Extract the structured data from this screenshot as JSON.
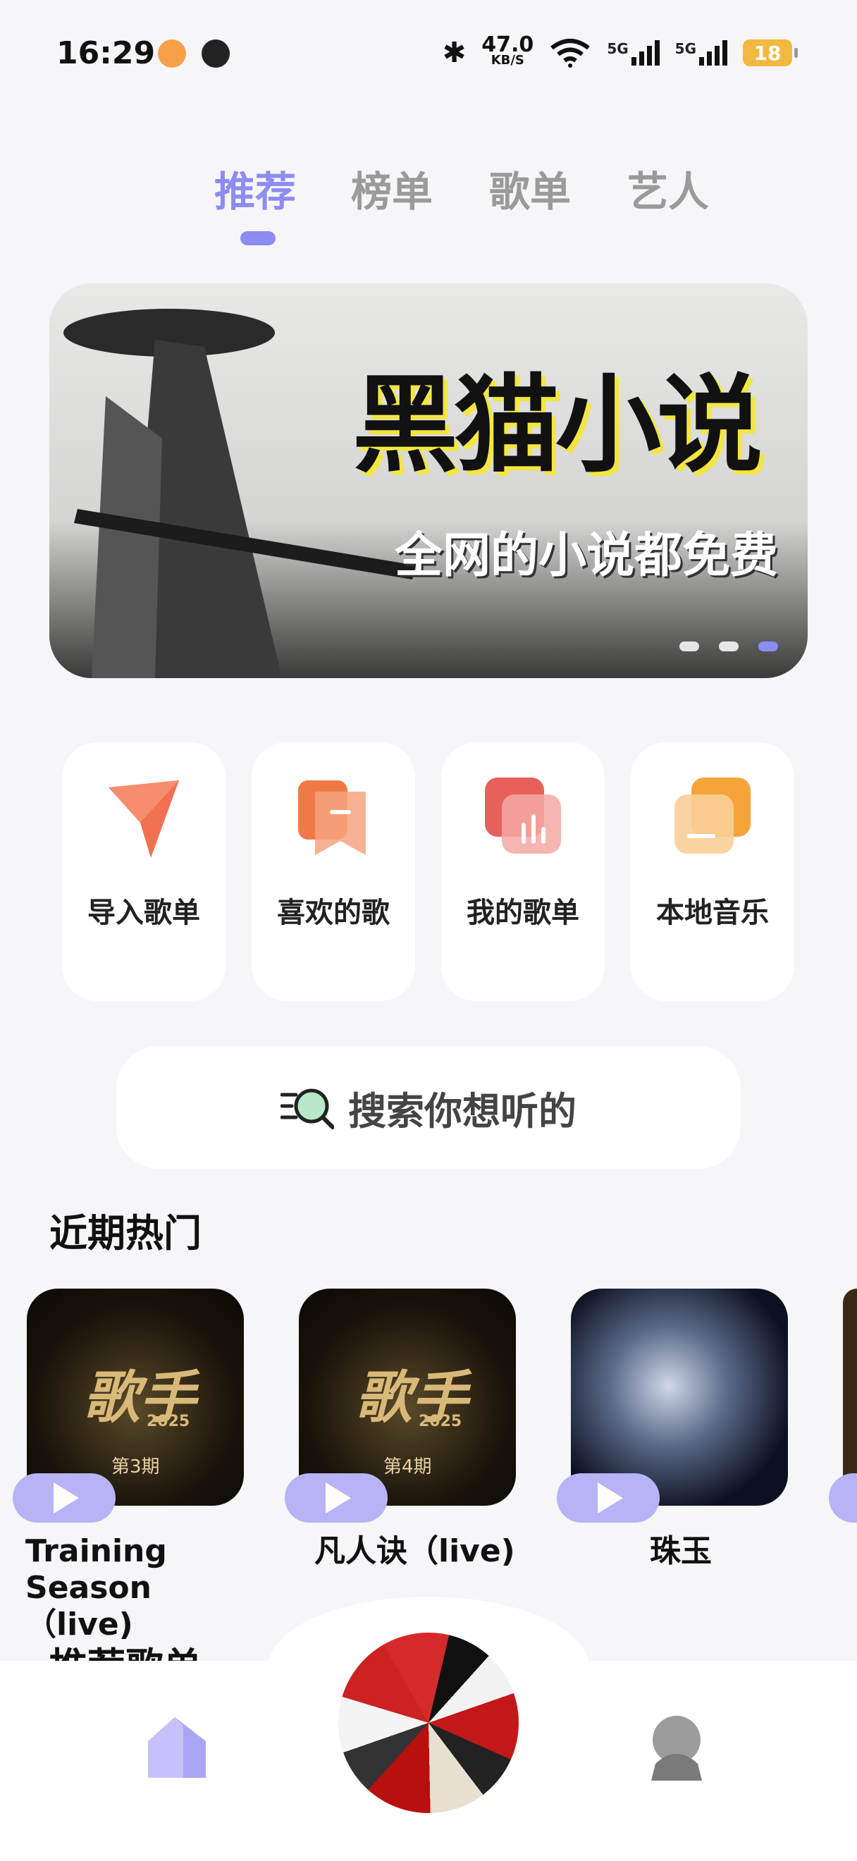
{
  "status_bar": {
    "time": "16:29",
    "net_speed_value": "47.0",
    "net_speed_unit": "KB/S",
    "signal1_label": "5G",
    "signal2_label": "5G",
    "battery": "18"
  },
  "tabs": [
    {
      "label": "推荐",
      "active": true
    },
    {
      "label": "榜单",
      "active": false
    },
    {
      "label": "歌单",
      "active": false
    },
    {
      "label": "艺人",
      "active": false
    }
  ],
  "banner": {
    "title": "黑猫小说",
    "subtitle": "全网的小说都免费",
    "page_count": 3,
    "active_page": 3
  },
  "shortcuts": [
    {
      "label": "导入歌单",
      "icon": "import-playlist-icon",
      "color": "#f0603c"
    },
    {
      "label": "喜欢的歌",
      "icon": "liked-songs-icon",
      "color": "#f07a45"
    },
    {
      "label": "我的歌单",
      "icon": "my-playlist-icon",
      "color": "#e8605a"
    },
    {
      "label": "本地音乐",
      "icon": "local-music-icon",
      "color": "#f5a43a"
    }
  ],
  "search": {
    "placeholder": "搜索你想听的"
  },
  "sections": {
    "recent_hot": "近期热门",
    "recommended_playlists": "推荐歌单"
  },
  "recent_hot_items": [
    {
      "title": "Training Season（live)",
      "cover_text": "歌手",
      "cover_year": "2025",
      "cover_episode": "第3期"
    },
    {
      "title": "凡人诀（live)",
      "cover_text": "歌手",
      "cover_year": "2025",
      "cover_episode": "第4期"
    },
    {
      "title": "珠玉",
      "cover_text": "",
      "cover_year": "",
      "cover_episode": ""
    }
  ],
  "colors": {
    "accent": "#8c8cf2",
    "play_pill": "#b8b2f6",
    "background": "#f6f6f8"
  }
}
